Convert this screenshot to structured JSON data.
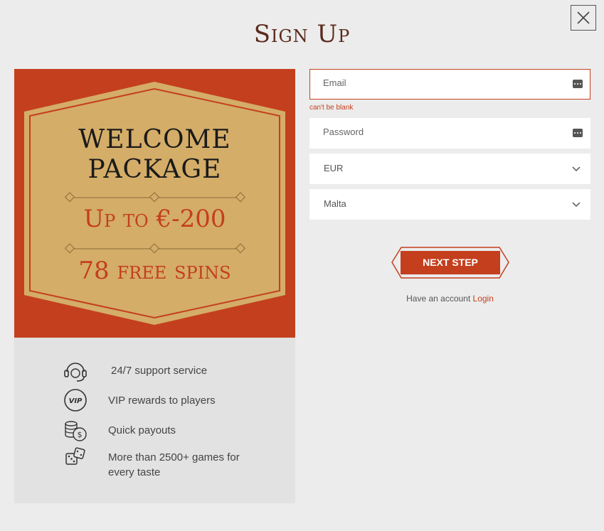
{
  "title": "Sign Up",
  "close_icon": "close-icon",
  "promo": {
    "line1": "WELCOME",
    "line2": "PACKAGE",
    "amount": "Up to €-200",
    "spins": "78 free spins"
  },
  "features": [
    {
      "icon": "headset-icon",
      "label": "24/7 support service"
    },
    {
      "icon": "vip-icon",
      "label": "VIP rewards to players"
    },
    {
      "icon": "coins-icon",
      "label": "Quick payouts"
    },
    {
      "icon": "dice-icon",
      "label": "More than 2500+ games for every taste"
    }
  ],
  "form": {
    "email_placeholder": "Email",
    "email_error": "can't be blank",
    "password_placeholder": "Password",
    "currency": "EUR",
    "country": "Malta",
    "next_label": "NEXT STEP",
    "have_account": "Have an account",
    "login_link": "Login"
  },
  "colors": {
    "accent": "#c43f1e",
    "gold": "#d4ad68",
    "title": "#5a2a1c"
  }
}
